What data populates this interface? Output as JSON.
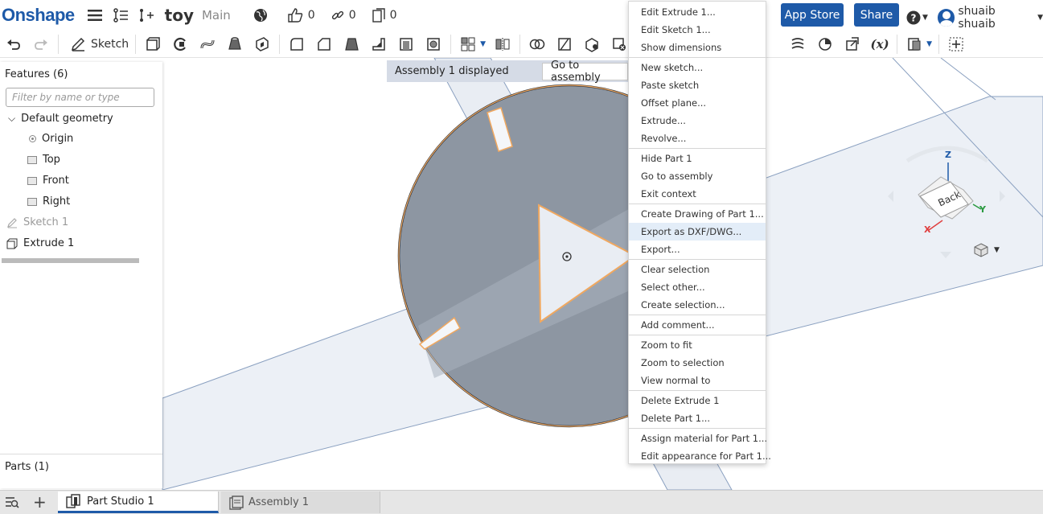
{
  "topbar": {
    "logo": "Onshape",
    "doc_title": "toy",
    "branch": "Main",
    "likes": "0",
    "links": "0",
    "copies": "0",
    "app_store": "App Store",
    "share": "Share",
    "user_name": "shuaib shuaib"
  },
  "toolbar": {
    "sketch_label": "Sketch"
  },
  "features": {
    "title": "Features (6)",
    "filter_placeholder": "Filter by name or type",
    "default_geometry": "Default geometry",
    "origin": "Origin",
    "top": "Top",
    "front": "Front",
    "right": "Right",
    "sketch": "Sketch 1",
    "extrude": "Extrude 1",
    "parts_title": "Parts (1)"
  },
  "banner": {
    "text": "Assembly 1 displayed",
    "button": "Go to assembly"
  },
  "context_menu": {
    "items": [
      "Edit Extrude 1...",
      "Edit Sketch 1...",
      "Show dimensions",
      "New sketch...",
      "Paste sketch",
      "Offset plane...",
      "Extrude...",
      "Revolve...",
      "Hide Part 1",
      "Go to assembly",
      "Exit context",
      "Create Drawing of Part 1...",
      "Export as DXF/DWG...",
      "Export...",
      "Clear selection",
      "Select other...",
      "Create selection...",
      "Add comment...",
      "Zoom to fit",
      "Zoom to selection",
      "View normal to",
      "Delete Extrude 1",
      "Delete Part 1...",
      "Assign material for Part 1...",
      "Edit appearance for Part 1..."
    ],
    "highlighted_index": 12
  },
  "view_cube": {
    "face_label": "Back",
    "axis_z": "Z",
    "axis_y": "Y",
    "axis_x": "X"
  },
  "tabs": {
    "part_studio": "Part Studio 1",
    "assembly": "Assembly 1"
  },
  "colors": {
    "brand": "#1e5aa8",
    "part_fill": "#8d96a2",
    "selection_edge": "#f0a860",
    "plane_fill": "#dde4ee",
    "menu_highlight": "#e3edf8"
  }
}
